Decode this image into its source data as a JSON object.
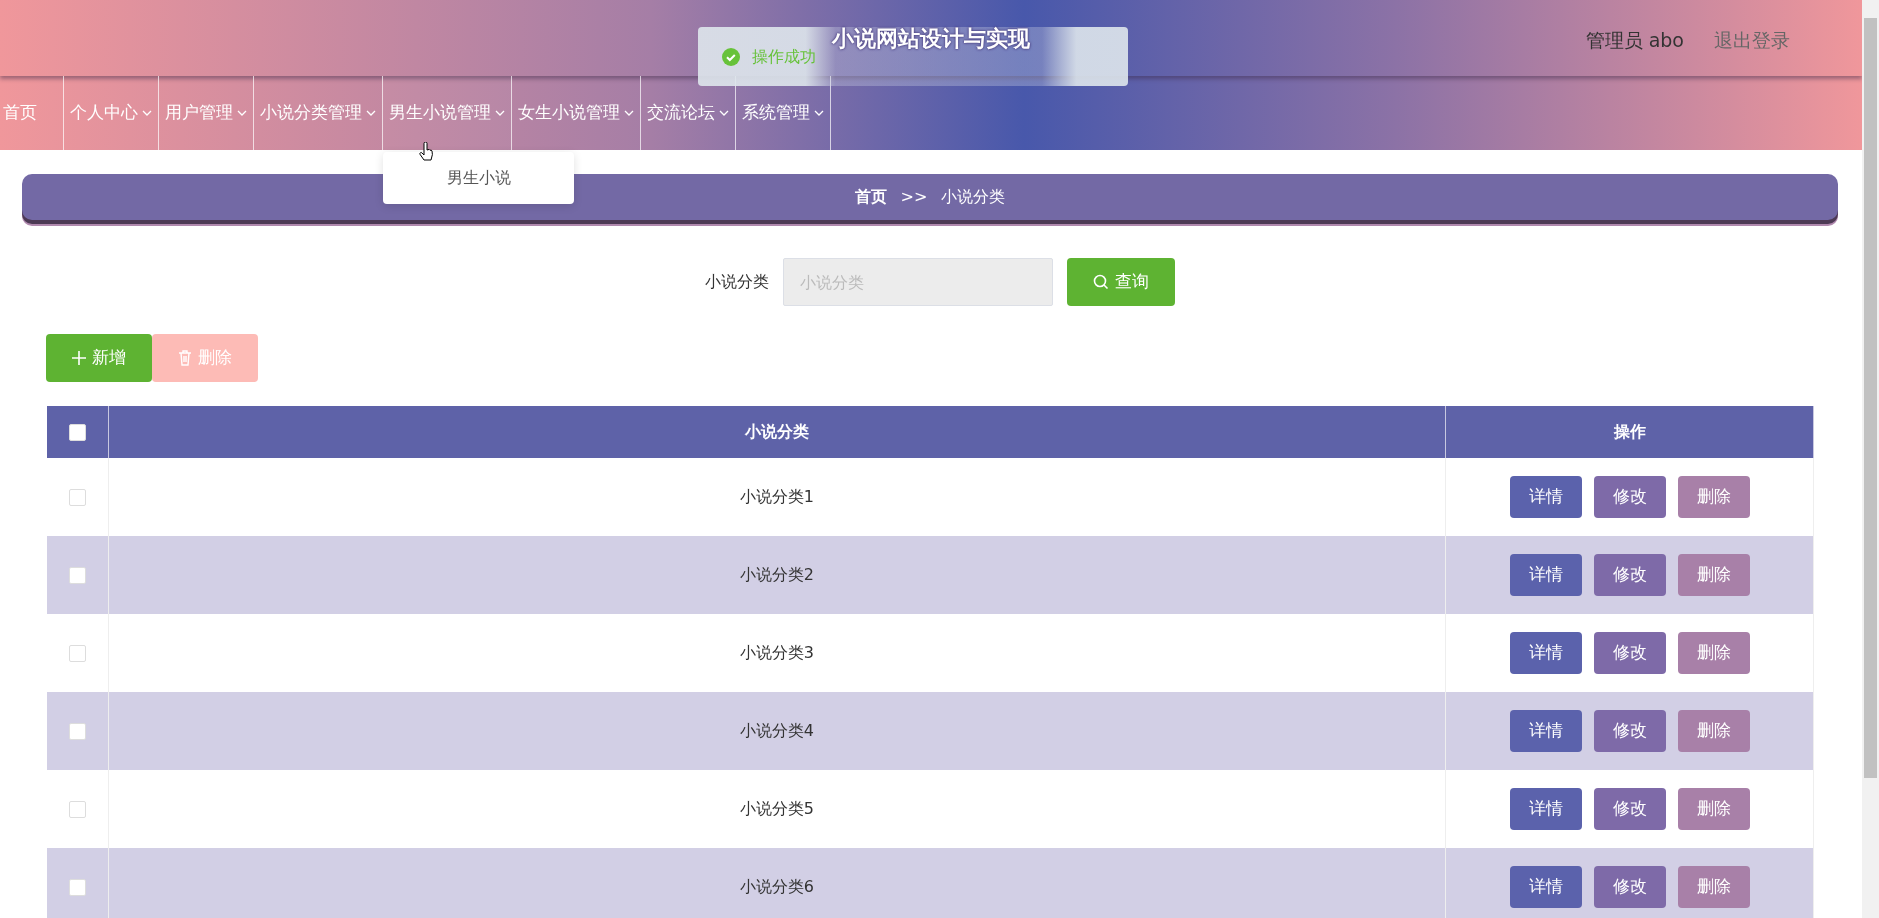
{
  "header": {
    "title": "小说网站设计与实现",
    "user": "管理员 abo",
    "logout": "退出登录"
  },
  "toast": {
    "message": "操作成功"
  },
  "nav": [
    {
      "label": "首页",
      "has_menu": false,
      "expanded": false
    },
    {
      "label": "个人中心",
      "has_menu": true,
      "expanded": false
    },
    {
      "label": "用户管理",
      "has_menu": true,
      "expanded": false
    },
    {
      "label": "小说分类管理",
      "has_menu": true,
      "expanded": false
    },
    {
      "label": "男生小说管理",
      "has_menu": true,
      "expanded": true,
      "menu": [
        "男生小说"
      ]
    },
    {
      "label": "女生小说管理",
      "has_menu": true,
      "expanded": false
    },
    {
      "label": "交流论坛",
      "has_menu": true,
      "expanded": false
    },
    {
      "label": "系统管理",
      "has_menu": true,
      "expanded": false
    }
  ],
  "breadcrumb": {
    "home": "首页",
    "separator": ">>",
    "current": "小说分类"
  },
  "search": {
    "label": "小说分类",
    "placeholder": "小说分类",
    "button": "查询"
  },
  "actions": [
    {
      "kind": "add",
      "label": "新增",
      "disabled": false
    },
    {
      "kind": "delete",
      "label": "删除",
      "disabled": true
    }
  ],
  "table": {
    "select_all_checked": false,
    "columns": [
      "小说分类",
      "操作"
    ],
    "rows": [
      {
        "name": "小说分类1",
        "checked": false,
        "actions": [
          "详情",
          "修改",
          "删除"
        ]
      },
      {
        "name": "小说分类2",
        "checked": false,
        "actions": [
          "详情",
          "修改",
          "删除"
        ]
      },
      {
        "name": "小说分类3",
        "checked": false,
        "actions": [
          "详情",
          "修改",
          "删除"
        ]
      },
      {
        "name": "小说分类4",
        "checked": false,
        "actions": [
          "详情",
          "修改",
          "删除"
        ]
      },
      {
        "name": "小说分类5",
        "checked": false,
        "actions": [
          "详情",
          "修改",
          "删除"
        ]
      },
      {
        "name": "小说分类6",
        "checked": false,
        "actions": [
          "详情",
          "修改",
          "删除"
        ]
      }
    ]
  }
}
